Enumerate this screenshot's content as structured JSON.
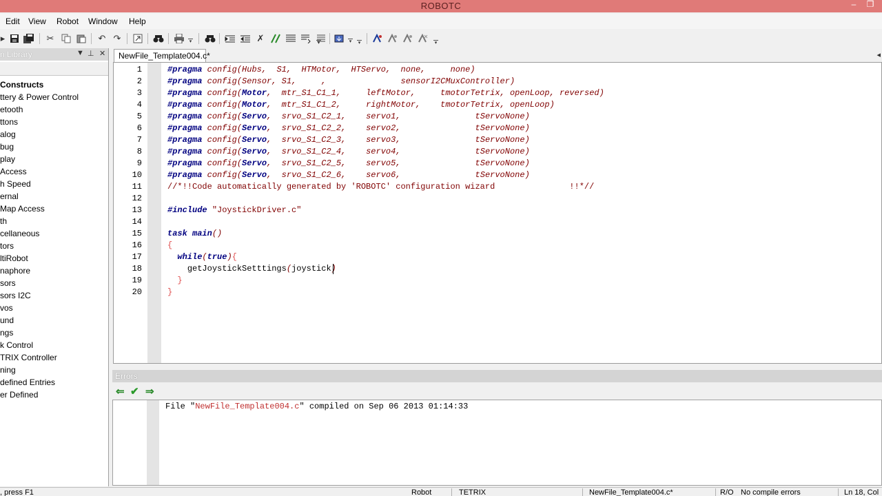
{
  "window": {
    "title": "ROBOTC",
    "minimize_glyph": "–",
    "restore_glyph": "❐"
  },
  "menu": [
    "Edit",
    "View",
    "Robot",
    "Window",
    "Help"
  ],
  "toolbar": {
    "icons": [
      "compile-icon",
      "save-icon",
      "save-all-icon",
      "cut-icon",
      "copy-icon",
      "paste-icon",
      "undo-icon",
      "redo-icon",
      "goto-icon",
      "find-icon",
      "print-icon",
      "find-next-icon",
      "indent-icon",
      "outdent-icon",
      "toggle-bookmark-icon",
      "comment-icon",
      "format-icon",
      "find-in-files-icon",
      "download-icon",
      "debug-icon",
      "step-icon",
      "step-over-icon",
      "breakpoint-icon"
    ]
  },
  "left_panel": {
    "title": "n Library",
    "items": [
      {
        "label": "Constructs",
        "bold": true
      },
      {
        "label": "ttery & Power Control"
      },
      {
        "label": "etooth"
      },
      {
        "label": "ttons"
      },
      {
        "label": "alog"
      },
      {
        "label": "bug"
      },
      {
        "label": "play"
      },
      {
        "label": "Access"
      },
      {
        "label": "h Speed"
      },
      {
        "label": "ernal"
      },
      {
        "label": "Map Access"
      },
      {
        "label": "th"
      },
      {
        "label": "cellaneous"
      },
      {
        "label": "tors"
      },
      {
        "label": "ltiRobot"
      },
      {
        "label": "naphore"
      },
      {
        "label": "sors"
      },
      {
        "label": "sors I2C"
      },
      {
        "label": "vos"
      },
      {
        "label": "und"
      },
      {
        "label": "ngs"
      },
      {
        "label": "k Control"
      },
      {
        "label": "TRIX Controller"
      },
      {
        "label": "ning"
      },
      {
        "label": "defined Entries"
      },
      {
        "label": "er Defined"
      }
    ]
  },
  "editor": {
    "tab_label": "NewFile_Template004.c*",
    "lines": [
      {
        "n": "1",
        "parts": [
          [
            "#pragma",
            "kw"
          ],
          [
            " ",
            "p"
          ],
          [
            "config",
            "fn"
          ],
          [
            "(",
            "p"
          ],
          [
            "Hubs",
            "fn"
          ],
          [
            ",  ",
            "p"
          ],
          [
            "S1",
            "fn"
          ],
          [
            ",  ",
            "p"
          ],
          [
            "HTMotor",
            "fn"
          ],
          [
            ",  ",
            "p"
          ],
          [
            "HTServo",
            "fn"
          ],
          [
            ",  ",
            "p"
          ],
          [
            "none",
            "fn"
          ],
          [
            ",     ",
            "p"
          ],
          [
            "none",
            "fn"
          ],
          [
            ")",
            "p"
          ]
        ]
      },
      {
        "n": "2",
        "parts": [
          [
            "#pragma",
            "kw"
          ],
          [
            " ",
            "p"
          ],
          [
            "config",
            "fn"
          ],
          [
            "(",
            "p"
          ],
          [
            "Sensor",
            "fn"
          ],
          [
            ", ",
            "p"
          ],
          [
            "S1",
            "fn"
          ],
          [
            ",     ,               ",
            "p"
          ],
          [
            "sensorI2CMuxController",
            "fn"
          ],
          [
            ")",
            "p"
          ]
        ]
      },
      {
        "n": "3",
        "parts": [
          [
            "#pragma",
            "kw"
          ],
          [
            " ",
            "p"
          ],
          [
            "config",
            "fn"
          ],
          [
            "(",
            "p"
          ],
          [
            "Motor",
            "kw"
          ],
          [
            ",  ",
            "p"
          ],
          [
            "mtr_S1_C1_1",
            "fn"
          ],
          [
            ",     ",
            "p"
          ],
          [
            "leftMotor",
            "fn"
          ],
          [
            ",     ",
            "p"
          ],
          [
            "tmotorTetrix",
            "fn"
          ],
          [
            ", ",
            "p"
          ],
          [
            "openLoop",
            "fn"
          ],
          [
            ", ",
            "p"
          ],
          [
            "reversed",
            "fn"
          ],
          [
            ")",
            "p"
          ]
        ]
      },
      {
        "n": "4",
        "parts": [
          [
            "#pragma",
            "kw"
          ],
          [
            " ",
            "p"
          ],
          [
            "config",
            "fn"
          ],
          [
            "(",
            "p"
          ],
          [
            "Motor",
            "kw"
          ],
          [
            ",  ",
            "p"
          ],
          [
            "mtr_S1_C1_2",
            "fn"
          ],
          [
            ",     ",
            "p"
          ],
          [
            "rightMotor",
            "fn"
          ],
          [
            ",    ",
            "p"
          ],
          [
            "tmotorTetrix",
            "fn"
          ],
          [
            ", ",
            "p"
          ],
          [
            "openLoop",
            "fn"
          ],
          [
            ")",
            "p"
          ]
        ]
      },
      {
        "n": "5",
        "parts": [
          [
            "#pragma",
            "kw"
          ],
          [
            " ",
            "p"
          ],
          [
            "config",
            "fn"
          ],
          [
            "(",
            "p"
          ],
          [
            "Servo",
            "kw"
          ],
          [
            ",  ",
            "p"
          ],
          [
            "srvo_S1_C2_1",
            "fn"
          ],
          [
            ",    ",
            "p"
          ],
          [
            "servo1",
            "fn"
          ],
          [
            ",               ",
            "p"
          ],
          [
            "tServoNone",
            "fn"
          ],
          [
            ")",
            "p"
          ]
        ]
      },
      {
        "n": "6",
        "parts": [
          [
            "#pragma",
            "kw"
          ],
          [
            " ",
            "p"
          ],
          [
            "config",
            "fn"
          ],
          [
            "(",
            "p"
          ],
          [
            "Servo",
            "kw"
          ],
          [
            ",  ",
            "p"
          ],
          [
            "srvo_S1_C2_2",
            "fn"
          ],
          [
            ",    ",
            "p"
          ],
          [
            "servo2",
            "fn"
          ],
          [
            ",               ",
            "p"
          ],
          [
            "tServoNone",
            "fn"
          ],
          [
            ")",
            "p"
          ]
        ]
      },
      {
        "n": "7",
        "parts": [
          [
            "#pragma",
            "kw"
          ],
          [
            " ",
            "p"
          ],
          [
            "config",
            "fn"
          ],
          [
            "(",
            "p"
          ],
          [
            "Servo",
            "kw"
          ],
          [
            ",  ",
            "p"
          ],
          [
            "srvo_S1_C2_3",
            "fn"
          ],
          [
            ",    ",
            "p"
          ],
          [
            "servo3",
            "fn"
          ],
          [
            ",               ",
            "p"
          ],
          [
            "tServoNone",
            "fn"
          ],
          [
            ")",
            "p"
          ]
        ]
      },
      {
        "n": "8",
        "parts": [
          [
            "#pragma",
            "kw"
          ],
          [
            " ",
            "p"
          ],
          [
            "config",
            "fn"
          ],
          [
            "(",
            "p"
          ],
          [
            "Servo",
            "kw"
          ],
          [
            ",  ",
            "p"
          ],
          [
            "srvo_S1_C2_4",
            "fn"
          ],
          [
            ",    ",
            "p"
          ],
          [
            "servo4",
            "fn"
          ],
          [
            ",               ",
            "p"
          ],
          [
            "tServoNone",
            "fn"
          ],
          [
            ")",
            "p"
          ]
        ]
      },
      {
        "n": "9",
        "parts": [
          [
            "#pragma",
            "kw"
          ],
          [
            " ",
            "p"
          ],
          [
            "config",
            "fn"
          ],
          [
            "(",
            "p"
          ],
          [
            "Servo",
            "kw"
          ],
          [
            ",  ",
            "p"
          ],
          [
            "srvo_S1_C2_5",
            "fn"
          ],
          [
            ",    ",
            "p"
          ],
          [
            "servo5",
            "fn"
          ],
          [
            ",               ",
            "p"
          ],
          [
            "tServoNone",
            "fn"
          ],
          [
            ")",
            "p"
          ]
        ]
      },
      {
        "n": "10",
        "parts": [
          [
            "#pragma",
            "kw"
          ],
          [
            " ",
            "p"
          ],
          [
            "config",
            "fn"
          ],
          [
            "(",
            "p"
          ],
          [
            "Servo",
            "kw"
          ],
          [
            ",  ",
            "p"
          ],
          [
            "srvo_S1_C2_6",
            "fn"
          ],
          [
            ",    ",
            "p"
          ],
          [
            "servo6",
            "fn"
          ],
          [
            ",               ",
            "p"
          ],
          [
            "tServoNone",
            "fn"
          ],
          [
            ")",
            "p"
          ]
        ]
      },
      {
        "n": "11",
        "parts": [
          [
            "//*!!Code automatically generated by 'ROBOTC' configuration wizard               !!*//",
            "cm"
          ]
        ]
      },
      {
        "n": "12",
        "parts": []
      },
      {
        "n": "13",
        "parts": [
          [
            "#include",
            "kw"
          ],
          [
            " ",
            "p"
          ],
          [
            "\"JoystickDriver.c\"",
            "str"
          ]
        ]
      },
      {
        "n": "14",
        "parts": []
      },
      {
        "n": "15",
        "parts": [
          [
            "task",
            "kw"
          ],
          [
            " ",
            "p"
          ],
          [
            "main",
            "kw"
          ],
          [
            "()",
            "p"
          ]
        ]
      },
      {
        "n": "16",
        "parts": [
          [
            "{",
            "brace"
          ]
        ]
      },
      {
        "n": "17",
        "parts": [
          [
            "  ",
            "p"
          ],
          [
            "while",
            "kw"
          ],
          [
            "(",
            "p"
          ],
          [
            "true",
            "kw"
          ],
          [
            ")",
            "p"
          ],
          [
            "{",
            "brace"
          ]
        ]
      },
      {
        "n": "18",
        "parts": [
          [
            "    ",
            "p"
          ],
          [
            "getJoystickSetttings",
            "plain"
          ],
          [
            "(",
            "p"
          ],
          [
            "joystick",
            "plain"
          ],
          [
            ")",
            "p"
          ]
        ]
      },
      {
        "n": "19",
        "parts": [
          [
            "  ",
            "p"
          ],
          [
            "}",
            "brace"
          ]
        ]
      },
      {
        "n": "20",
        "parts": [
          [
            "}",
            "brace"
          ]
        ]
      }
    ]
  },
  "errors": {
    "title": "Errors",
    "message_prefix": "File \"",
    "file_name": "NewFile_Template004.c",
    "message_suffix": "\" compiled on Sep 06 2013 01:14:33"
  },
  "status": {
    "help": ", press F1",
    "robot": "Robot",
    "platform": "TETRIX",
    "file": "NewFile_Template004.c*",
    "mode": "R/O",
    "compile": "No compile errors",
    "position": "Ln 18, Col"
  },
  "colors": {
    "titlebar": "#e07a78",
    "keyword": "#000080",
    "identifier": "#800000",
    "punct": "#800000",
    "string": "#800000",
    "comment": "#800000",
    "brace": "#e05050",
    "plain": "#000000",
    "file_name": "#c03030"
  }
}
